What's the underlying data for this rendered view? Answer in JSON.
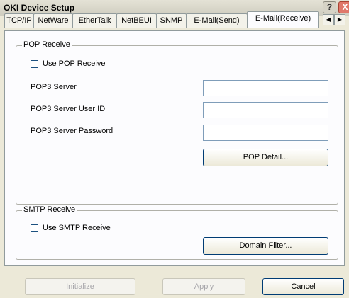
{
  "window": {
    "title": "OKI Device Setup",
    "help_label": "?",
    "close_label": "X"
  },
  "tabs": [
    {
      "label": "TCP/IP",
      "active": false
    },
    {
      "label": "NetWare",
      "active": false
    },
    {
      "label": "EtherTalk",
      "active": false
    },
    {
      "label": "NetBEUI",
      "active": false
    },
    {
      "label": "SNMP",
      "active": false
    },
    {
      "label": "E-Mail(Send)",
      "active": false
    },
    {
      "label": "E-Mail(Receive)",
      "active": true
    }
  ],
  "tab_scroll": {
    "left": "◀",
    "right": "▶"
  },
  "pop_receive": {
    "legend": "POP Receive",
    "use_label": "Use POP Receive",
    "use_checked": false,
    "server_label": "POP3 Server",
    "server_value": "",
    "user_label": "POP3 Server User ID",
    "user_value": "",
    "password_label": "POP3 Server Password",
    "password_value": "",
    "detail_button": "POP Detail..."
  },
  "smtp_receive": {
    "legend": "SMTP Receive",
    "use_label": "Use SMTP Receive",
    "use_checked": false,
    "domain_button": "Domain Filter..."
  },
  "footer": {
    "initialize": "Initialize",
    "apply": "Apply",
    "cancel": "Cancel"
  }
}
